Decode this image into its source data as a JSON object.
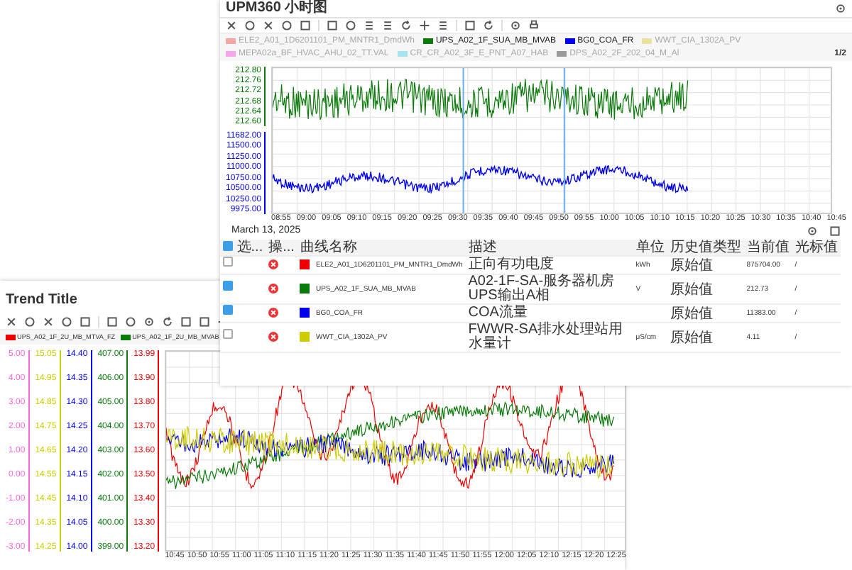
{
  "back_window": {
    "title": "UPM360 小时图",
    "legend": [
      {
        "label": "ELE2_A01_1D6201101_PM_MNTR1_DmdWh",
        "color": "#f4a6a6",
        "visible": false
      },
      {
        "label": "UPS_A02_1F_SUA_MB_MVAB",
        "color": "#0a7a0a",
        "visible": true
      },
      {
        "label": "BG0_COA_FR",
        "color": "#0000ee",
        "visible": true
      },
      {
        "label": "WWT_CIA_1302A_PV",
        "color": "#e8e4a0",
        "visible": false
      },
      {
        "label": "MEPA02a_BF_HVAC_AHU_02_TT.VAL",
        "color": "#f4a6e8",
        "visible": false
      },
      {
        "label": "CR_CR_A02_3F_E_PNT_A07_HAB",
        "color": "#a6e4ee",
        "visible": false
      },
      {
        "label": "DPS_A02_2F_202_04_M_Al",
        "color": "#9a9a9a",
        "visible": false
      }
    ],
    "legend_page": "1/2",
    "y_axes": [
      {
        "color": "#0a7a0a",
        "ticks": [
          "212.80",
          "212.76",
          "212.72",
          "212.68",
          "212.64",
          "212.60"
        ]
      },
      {
        "color": "#0000ee",
        "ticks": [
          "11682.00",
          "11500.00",
          "11250.00",
          "11000.00",
          "10750.00",
          "10500.00",
          "10250.00",
          "9975.00"
        ]
      }
    ],
    "x_ticks": [
      "08:55",
      "09:00",
      "09:05",
      "09:10",
      "09:15",
      "09:20",
      "09:25",
      "09:30",
      "09:35",
      "09:40",
      "09:45",
      "09:50",
      "09:55",
      "10:00",
      "10:05",
      "10:10",
      "10:15",
      "10:20",
      "10:25",
      "10:30",
      "10:35",
      "10:40",
      "10:45"
    ],
    "date": "March 13, 2025",
    "table": {
      "all_checked": true,
      "columns": [
        "选...",
        "操...",
        "曲线名称",
        "描述",
        "单位",
        "历史值类型",
        "当前值",
        "光标值"
      ],
      "rows": [
        {
          "checked": false,
          "color": "#ee0000",
          "cells": [
            "",
            "",
            "ELE2_A01_1D6201101_PM_MNTR1_DmdWh",
            "正向有功电度",
            "kWh",
            "原始值",
            "875704.00",
            "/"
          ]
        },
        {
          "checked": true,
          "color": "#0a7a0a",
          "cells": [
            "",
            "",
            "UPS_A02_1F_SUA_MB_MVAB",
            "A02-1F-SA-服务器机房UPS输出A相",
            "V",
            "原始值",
            "212.73",
            "/"
          ]
        },
        {
          "checked": true,
          "color": "#0000ee",
          "cells": [
            "",
            "",
            "BG0_COA_FR",
            "COA流量",
            "",
            "原始值",
            "11383.00",
            "/"
          ]
        },
        {
          "checked": false,
          "color": "#cccc00",
          "cells": [
            "",
            "",
            "WWT_CIA_1302A_PV",
            "FWWR-SA排水处理站用水量计",
            "μS/cm",
            "原始值",
            "4.11",
            "/"
          ]
        }
      ]
    }
  },
  "front_window": {
    "title": "Trend Title",
    "legend": [
      {
        "label": "UPS_A02_1F_2U_MB_MTVA_FZ",
        "color": "#ee0000"
      },
      {
        "label": "UPS_A02_1F_2U_MB_MVAB",
        "color": "#0a7a0a"
      }
    ],
    "y_axes": [
      {
        "color": "#ff66dd",
        "ticks": [
          "5.00",
          "4.00",
          "3.00",
          "2.00",
          "1.00",
          "0.00",
          "-1.00",
          "-2.00",
          "-3.00"
        ]
      },
      {
        "color": "#cccc00",
        "ticks": [
          "15.05",
          "14.95",
          "14.85",
          "14.75",
          "14.65",
          "14.55",
          "14.45",
          "14.35",
          "14.25"
        ]
      },
      {
        "color": "#0000ee",
        "ticks": [
          "14.40",
          "14.35",
          "14.30",
          "14.25",
          "14.20",
          "14.15",
          "14.10",
          "14.05",
          "14.00"
        ]
      },
      {
        "color": "#0a7a0a",
        "ticks": [
          "407.00",
          "406.00",
          "405.00",
          "404.00",
          "403.00",
          "402.00",
          "401.00",
          "400.00",
          "399.00"
        ]
      },
      {
        "color": "#ee0000",
        "ticks": [
          "13.99",
          "13.90",
          "13.80",
          "13.70",
          "13.60",
          "13.50",
          "13.40",
          "13.30",
          "13.20"
        ]
      }
    ],
    "x_ticks": [
      "10:45",
      "10:50",
      "10:55",
      "11:00",
      "11:05",
      "11:10",
      "11:15",
      "11:20",
      "11:25",
      "11:30",
      "11:35",
      "11:40",
      "11:45",
      "11:50",
      "11:55",
      "12:00",
      "12:05",
      "12:10",
      "12:15",
      "12:20",
      "12:25"
    ]
  }
}
